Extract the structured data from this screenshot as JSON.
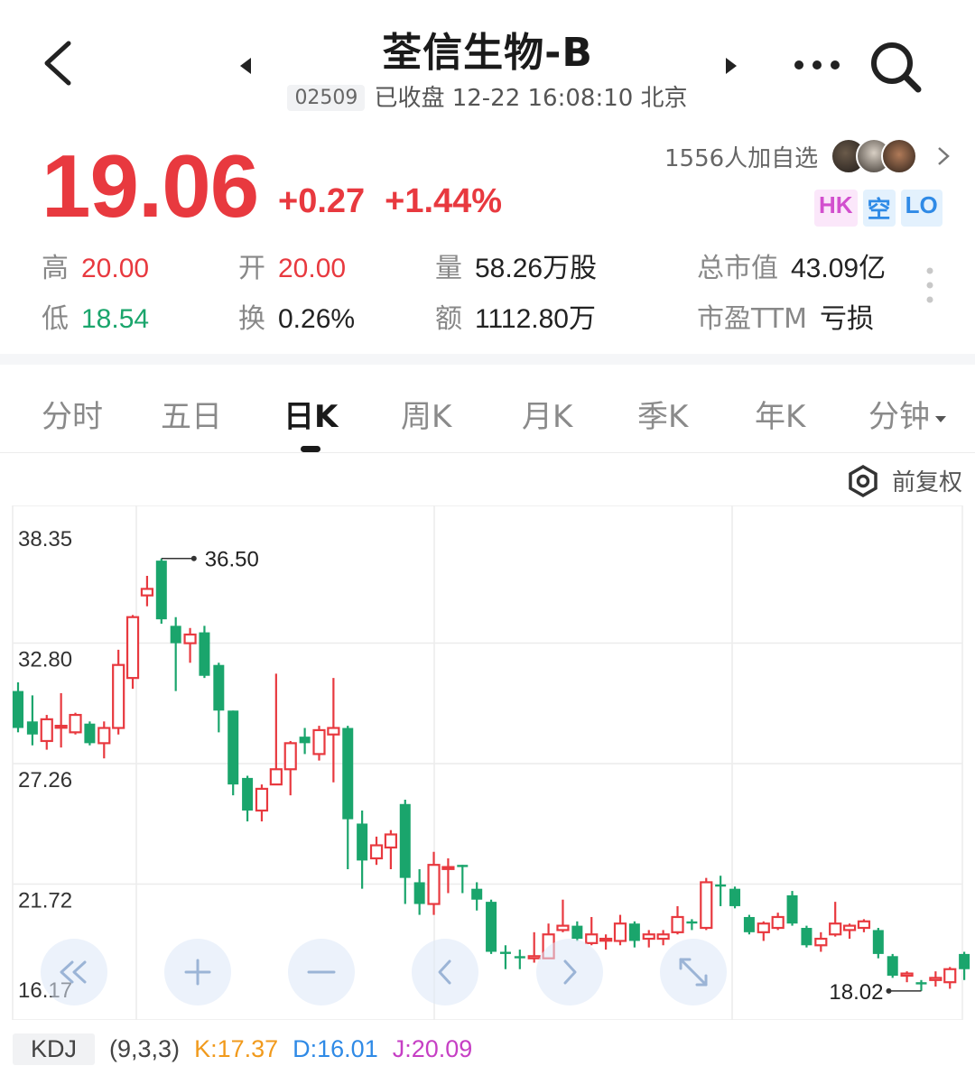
{
  "header": {
    "title": "荃信生物-B",
    "code": "02509",
    "status": "已收盘 12-22 16:08:10 北京"
  },
  "quote": {
    "price": "19.06",
    "change": "+0.27",
    "change_pct": "+1.44%",
    "watchers": "1556人加自选",
    "badges": [
      "HK",
      "空",
      "LO"
    ]
  },
  "stats": {
    "high_label": "高",
    "high": "20.00",
    "low_label": "低",
    "low": "18.54",
    "open_label": "开",
    "open": "20.00",
    "turnover_label": "换",
    "turnover": "0.26%",
    "volume_label": "量",
    "volume": "58.26万股",
    "amount_label": "额",
    "amount": "1112.80万",
    "mktcap_label": "总市值",
    "mktcap": "43.09亿",
    "pe_label": "市盈TTM",
    "pe": "亏损"
  },
  "tabs": [
    "分时",
    "五日",
    "日K",
    "周K",
    "月K",
    "季K",
    "年K",
    "分钟"
  ],
  "active_tab": "日K",
  "adjust_label": "前复权",
  "chart_data": {
    "type": "candlestick",
    "y_ticks": [
      "38.35",
      "32.80",
      "27.26",
      "21.72",
      "16.17"
    ],
    "ylim": [
      16.17,
      38.35
    ],
    "high_marker": "36.50",
    "low_marker": "18.02",
    "candles": [
      [
        30.6,
        28.9,
        31.0,
        28.7
      ],
      [
        29.2,
        28.6,
        30.4,
        28.1
      ],
      [
        28.3,
        29.3,
        29.5,
        27.9
      ],
      [
        29.0,
        29.0,
        30.5,
        28.0
      ],
      [
        28.7,
        29.5,
        29.6,
        28.6
      ],
      [
        29.1,
        28.2,
        29.2,
        28.1
      ],
      [
        28.2,
        28.9,
        29.2,
        27.5
      ],
      [
        28.9,
        31.8,
        32.5,
        28.6
      ],
      [
        31.2,
        34.0,
        34.1,
        30.7
      ],
      [
        35.0,
        35.3,
        35.9,
        34.5
      ],
      [
        36.6,
        33.9,
        36.7,
        33.7
      ],
      [
        33.6,
        32.8,
        34.0,
        30.6
      ],
      [
        32.8,
        33.2,
        33.5,
        31.9
      ],
      [
        33.3,
        31.3,
        33.6,
        31.2
      ],
      [
        31.8,
        29.7,
        31.9,
        28.7
      ],
      [
        29.7,
        26.3,
        29.7,
        25.8
      ],
      [
        26.6,
        25.1,
        26.7,
        24.6
      ],
      [
        25.1,
        26.1,
        26.3,
        24.6
      ],
      [
        26.3,
        27.0,
        31.4,
        26.3
      ],
      [
        27.0,
        28.2,
        28.3,
        25.8
      ],
      [
        28.5,
        28.2,
        28.9,
        27.7
      ],
      [
        27.7,
        28.8,
        29.0,
        27.4
      ],
      [
        28.6,
        28.9,
        31.2,
        26.4
      ],
      [
        28.9,
        24.7,
        29.0,
        22.4
      ],
      [
        24.5,
        22.8,
        25.1,
        21.5
      ],
      [
        22.9,
        23.5,
        23.9,
        22.6
      ],
      [
        23.4,
        24.0,
        24.2,
        22.4
      ],
      [
        25.4,
        22.0,
        25.6,
        20.8
      ],
      [
        21.8,
        20.8,
        22.4,
        20.3
      ],
      [
        20.8,
        22.6,
        23.2,
        20.3
      ],
      [
        22.5,
        22.5,
        22.9,
        21.3
      ],
      [
        22.6,
        22.5,
        22.6,
        21.3
      ],
      [
        21.5,
        21.0,
        21.8,
        20.5
      ],
      [
        20.9,
        18.6,
        21.0,
        18.5
      ],
      [
        18.6,
        18.5,
        18.9,
        17.8
      ],
      [
        18.4,
        18.3,
        18.7,
        17.8
      ],
      [
        18.3,
        18.4,
        19.5,
        18.1
      ],
      [
        18.3,
        19.4,
        19.9,
        18.3
      ],
      [
        19.6,
        19.8,
        21.0,
        19.5
      ],
      [
        19.8,
        19.2,
        20.0,
        19.1
      ],
      [
        19.0,
        19.4,
        20.2,
        18.9
      ],
      [
        19.2,
        19.2,
        19.4,
        18.7
      ],
      [
        19.1,
        19.9,
        20.3,
        18.9
      ],
      [
        19.9,
        19.1,
        20.0,
        18.8
      ],
      [
        19.2,
        19.4,
        19.6,
        18.8
      ],
      [
        19.2,
        19.4,
        19.6,
        18.9
      ],
      [
        19.5,
        20.2,
        20.7,
        19.4
      ],
      [
        20.0,
        19.9,
        20.1,
        19.6
      ],
      [
        19.7,
        21.8,
        22.0,
        19.6
      ],
      [
        21.7,
        21.6,
        22.1,
        20.7
      ],
      [
        21.5,
        20.7,
        21.6,
        20.6
      ],
      [
        20.2,
        19.5,
        20.3,
        19.4
      ],
      [
        19.5,
        19.9,
        20.0,
        19.1
      ],
      [
        19.7,
        20.2,
        20.4,
        19.6
      ],
      [
        21.2,
        19.9,
        21.4,
        19.8
      ],
      [
        19.7,
        18.9,
        19.8,
        18.8
      ],
      [
        18.9,
        19.2,
        19.5,
        18.6
      ],
      [
        19.4,
        19.9,
        20.9,
        19.3
      ],
      [
        19.6,
        19.8,
        19.9,
        19.2
      ],
      [
        19.7,
        20.0,
        20.1,
        19.5
      ],
      [
        19.6,
        18.5,
        19.7,
        18.3
      ],
      [
        18.4,
        17.5,
        18.5,
        17.4
      ],
      [
        17.5,
        17.6,
        17.7,
        17.2
      ],
      [
        17.2,
        17.1,
        17.3,
        16.8
      ],
      [
        17.3,
        17.4,
        17.7,
        17.0
      ],
      [
        17.2,
        17.8,
        17.9,
        16.9
      ],
      [
        18.5,
        17.8,
        18.6,
        17.3
      ]
    ],
    "indicator": {
      "name": "KDJ",
      "params": "(9,3,3)",
      "K": "K:17.37",
      "D": "D:16.01",
      "J": "J:20.09"
    }
  },
  "chart_controls": [
    "double-left-icon",
    "plus-icon",
    "minus-icon",
    "chevron-left-icon",
    "chevron-right-icon",
    "expand-icon"
  ],
  "colors": {
    "up": "#e8393f",
    "down": "#1aa56c"
  }
}
